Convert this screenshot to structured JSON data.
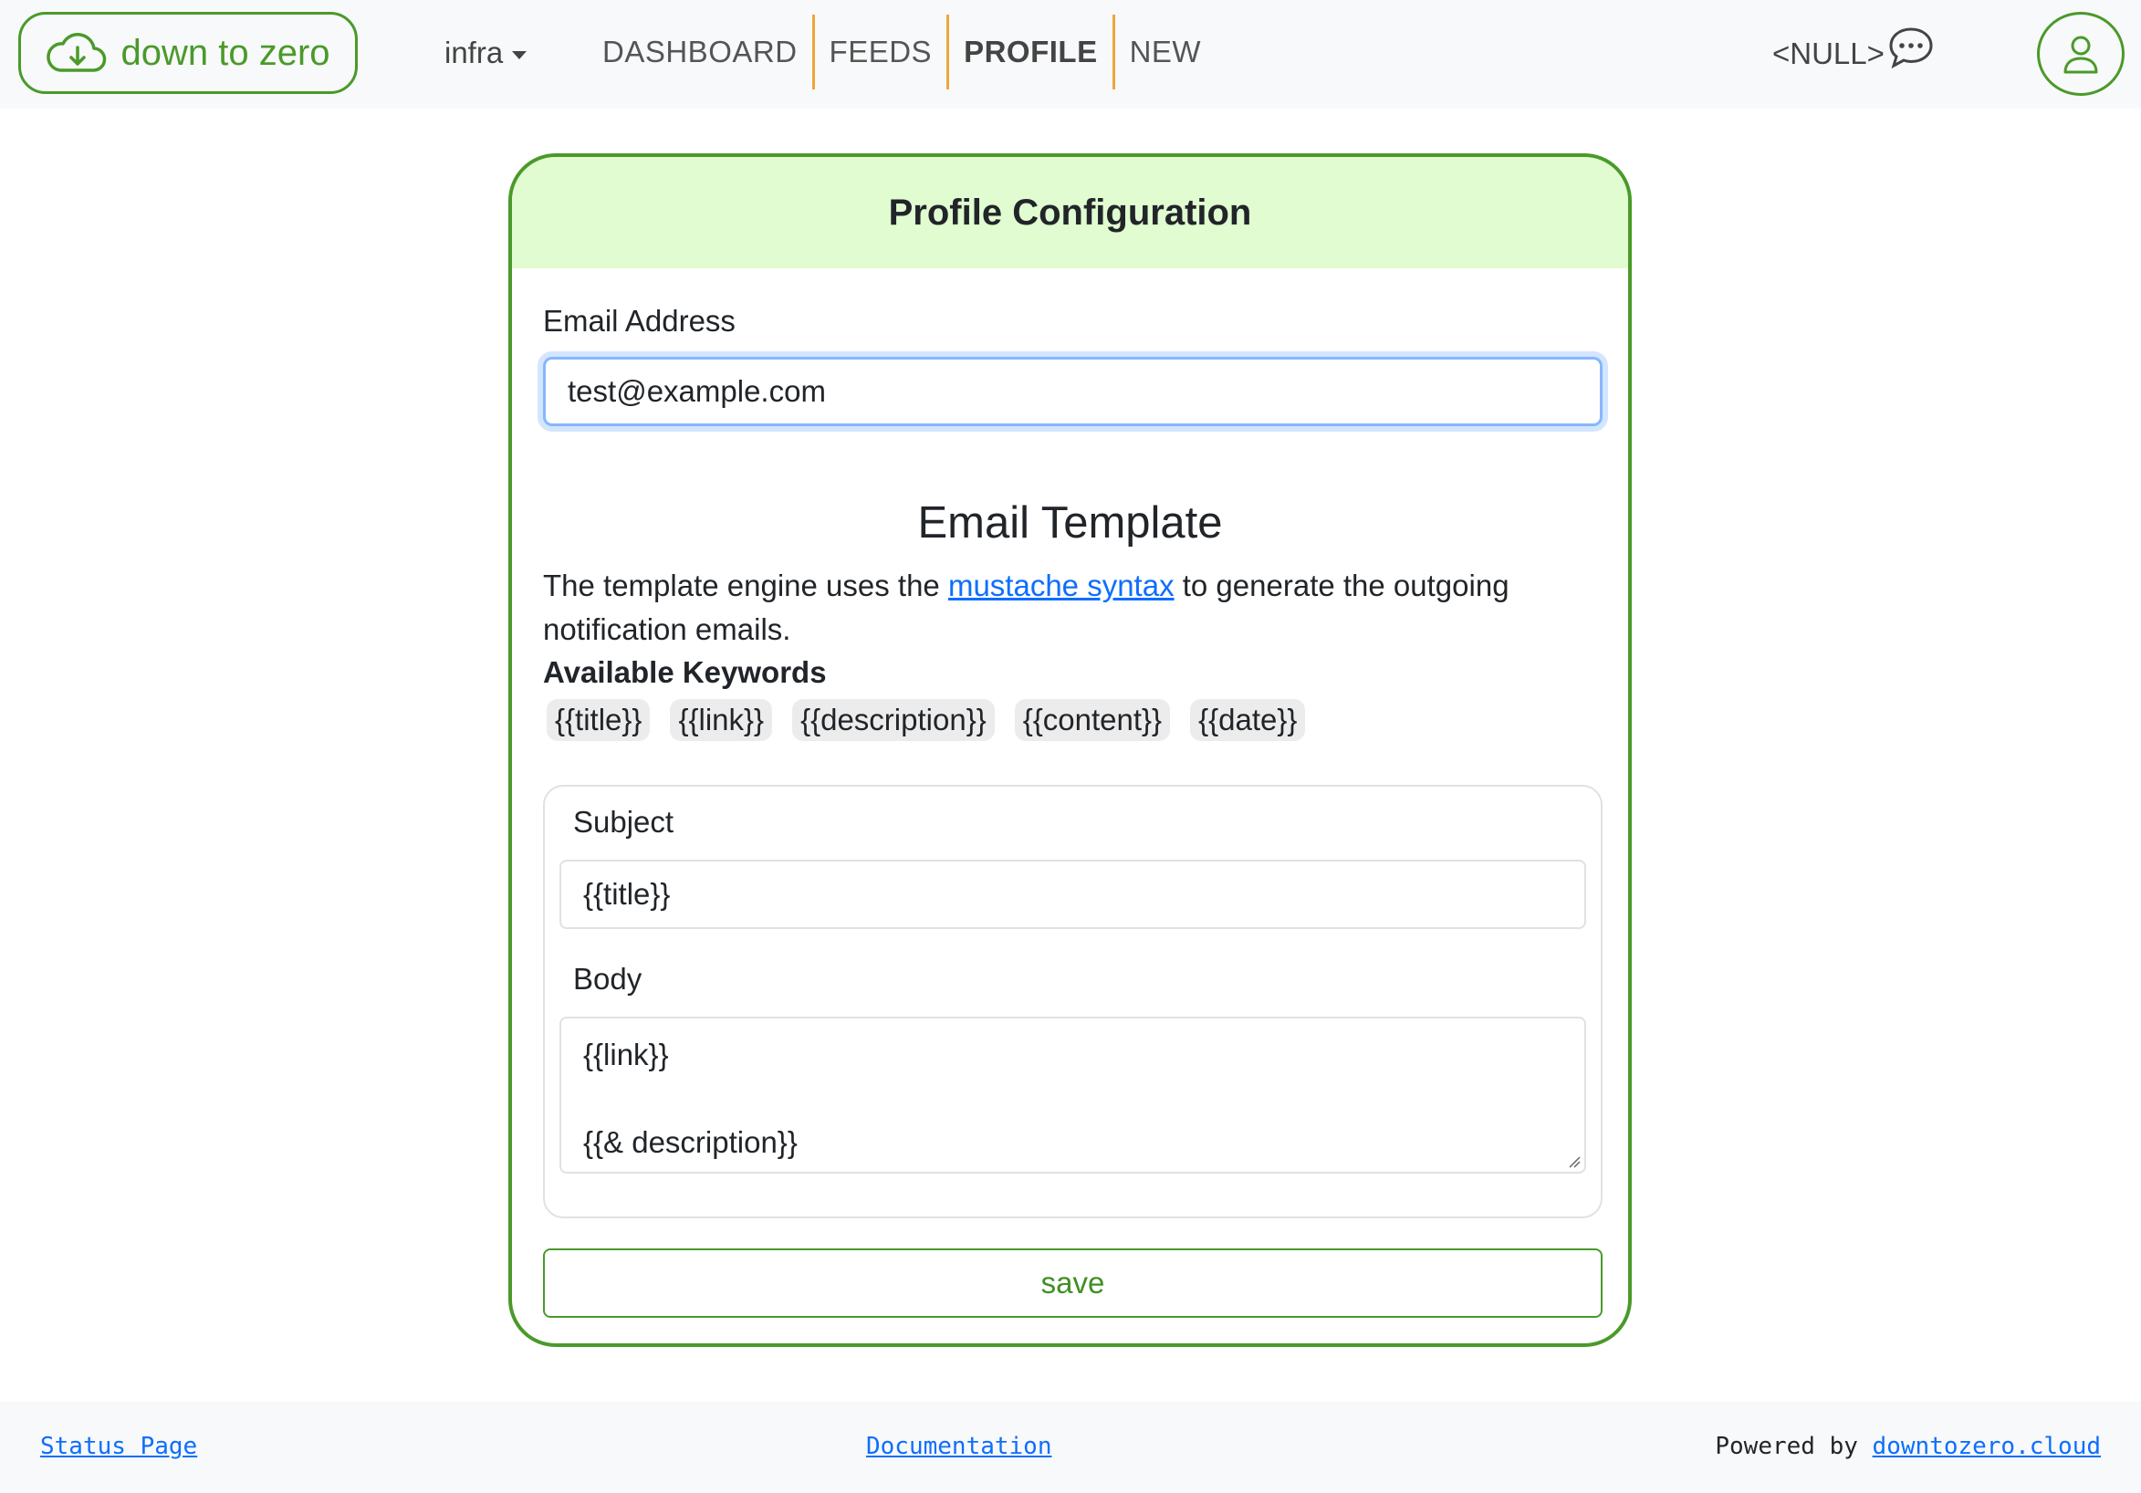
{
  "navbar": {
    "brand": "down to zero",
    "env": "infra",
    "links": [
      "DASHBOARD",
      "FEEDS",
      "PROFILE",
      "NEW"
    ],
    "active": "PROFILE",
    "user_name": "<NULL>"
  },
  "card": {
    "title": "Profile Configuration",
    "email_label": "Email Address",
    "email_value": "test@example.com",
    "template_title": "Email Template",
    "desc_before": "The template engine uses the ",
    "desc_link": "mustache syntax",
    "desc_after": " to generate the outgoing notification emails.",
    "keywords_title": "Available Keywords",
    "keywords": [
      "{{title}}",
      "{{link}}",
      "{{description}}",
      "{{content}}",
      "{{date}}"
    ],
    "subject_label": "Subject",
    "subject_value": "{{title}}",
    "body_label": "Body",
    "body_value": "{{link}}\n\n{{& description}}",
    "save_label": "save"
  },
  "footer": {
    "status_page": "Status Page",
    "documentation": "Documentation",
    "powered_by": "Powered by ",
    "powered_link": "downtozero.cloud"
  },
  "colors": {
    "brand_green": "#4a9a2a",
    "header_bg": "#e0fcd0",
    "nav_separator": "#f0a53c",
    "link_blue": "#0d6efd"
  }
}
